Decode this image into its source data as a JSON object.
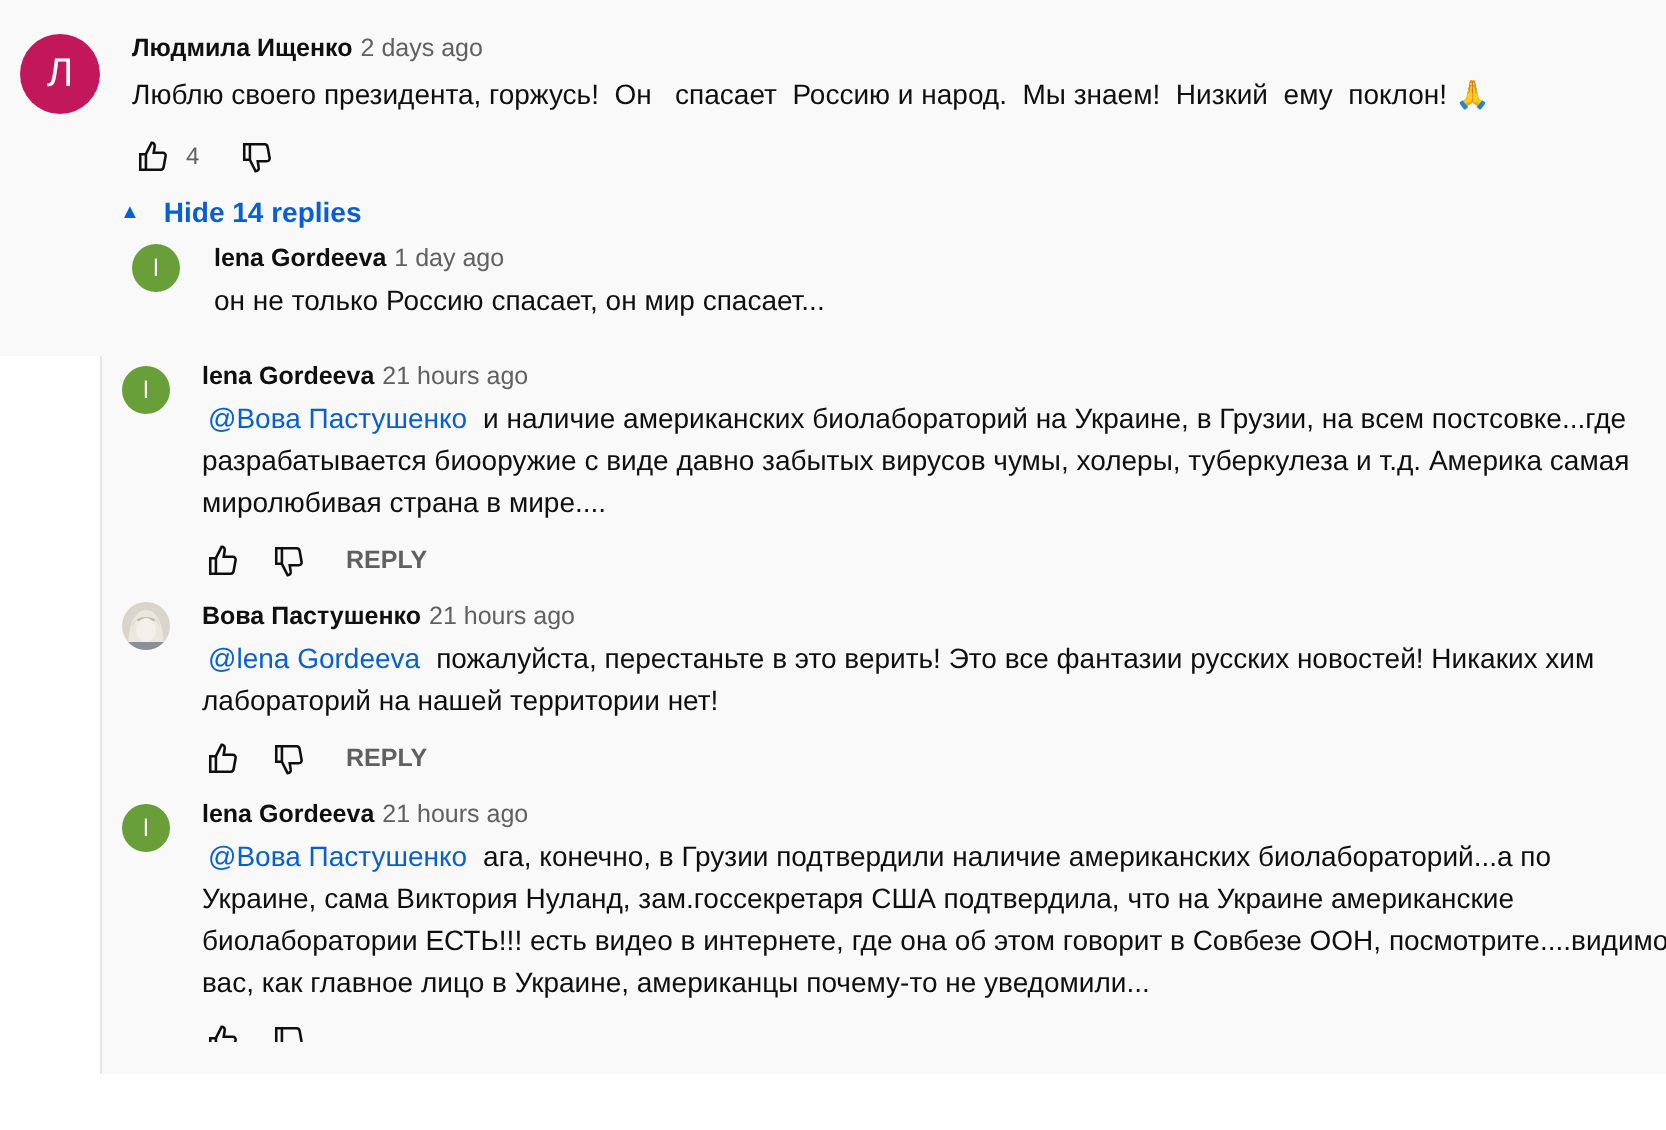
{
  "top_comment": {
    "author": "Людмила Ищенко",
    "time": "2 days ago",
    "avatar": {
      "letter": "Л",
      "color": "#c2185b"
    },
    "lines": [
      "Люблю своего президента, горжусь!  Он   спасает  Россию и народ.  Мы знаем!  Низкий  ему  поклон! 🙏"
    ],
    "likes": "4"
  },
  "replies_toggle": {
    "icon": "▲",
    "label": "Hide 14 replies"
  },
  "replies": [
    {
      "author": "lena Gordeeva",
      "time": "1 day ago",
      "avatar": {
        "kind": "letter",
        "letter": "l",
        "color": "#689f38"
      },
      "lines": [
        "он не только Россию спасает, он мир спасает..."
      ],
      "actions": false
    },
    {
      "author": "lena Gordeeva",
      "time": "21 hours ago",
      "avatar": {
        "kind": "letter",
        "letter": "l",
        "color": "#689f38"
      },
      "mention": "@Вова Пастушенко",
      "lines": [
        "и наличие американских биолабораторий на Украине, в Грузии, на всем постсовке...где",
        "разрабатывается биооружие с виде давно забытых вирусов чумы, холеры, туберкулеза и т.д. Америка самая",
        "миролюбивая страна в мире...."
      ],
      "actions": true,
      "reply": "REPLY"
    },
    {
      "author": "Вова Пастушенко",
      "time": "21 hours ago",
      "avatar": {
        "kind": "picture"
      },
      "mention": "@lena Gordeeva",
      "lines": [
        "пожалуйста, перестаньте в это верить! Это все фантазии русских новостей! Никаких хим",
        "лабораторий на нашей территории нет!"
      ],
      "actions": true,
      "reply": "REPLY"
    },
    {
      "author": "lena Gordeeva",
      "time": "21 hours ago",
      "avatar": {
        "kind": "letter",
        "letter": "l",
        "color": "#689f38"
      },
      "mention": "@Вова Пастушенко",
      "lines": [
        "ага, конечно, в Грузии подтвердили наличие американских биолабораторий...а по",
        "Украине, сама Виктория Нуланд, зам.госсекретаря США подтвердила, что на Украине американские",
        "биолаборатории ЕСТЬ!!! есть видео в интернете, где она об этом говорит в Совбезе ООН, посмотрите....видимо",
        "вас, как главное лицо в Украине, американцы почему-то не уведомили..."
      ],
      "actions": true
    }
  ]
}
